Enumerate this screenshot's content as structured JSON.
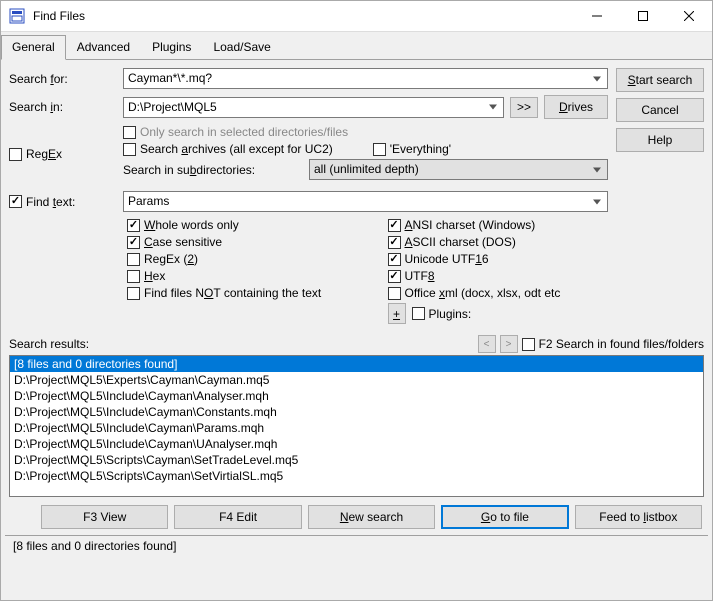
{
  "window": {
    "title": "Find Files"
  },
  "tabs": [
    "General",
    "Advanced",
    "Plugins",
    "Load/Save"
  ],
  "labels": {
    "search_for_pre": "Search ",
    "search_for_u": "f",
    "search_for_post": "or:",
    "search_in_pre": "Search ",
    "search_in_u": "i",
    "search_in_post": "n:",
    "browse_more": ">>",
    "drives_u": "D",
    "drives_post": "rives",
    "regex_pre": "Reg",
    "regex_u": "E",
    "regex_post": "x",
    "only_selected": "Only search in selected directories/files",
    "archives_pre": "Search ",
    "archives_u": "a",
    "archives_post": "rchives (all except for UC2)",
    "everything": "'Everything'",
    "subdirs_pre": "Search in su",
    "subdirs_u": "b",
    "subdirs_post": "directories:",
    "findtext_pre": "Find ",
    "findtext_u": "t",
    "findtext_post": "ext:",
    "whole_u": "W",
    "whole_post": "hole words only",
    "case_u": "C",
    "case_post": "ase sensitive",
    "regex2_pre": "RegEx (",
    "regex2_u": "2",
    "regex2_post": ")",
    "hex_u": "H",
    "hex_post": "ex",
    "notcontain_pre": "Find files N",
    "notcontain_u": "O",
    "notcontain_post": "T containing the text",
    "ansi_u": "A",
    "ansi_post": "NSI charset (Windows)",
    "ascii_u": "A",
    "ascii_post": "SCII charset (DOS)",
    "utf16_pre": "Unicode UTF",
    "utf16_u": "1",
    "utf16_post": "6",
    "utf8_pre": "UTF",
    "utf8_u": "8",
    "office_pre": "Office ",
    "office_u": "x",
    "office_post": "ml (docx, xlsx, odt etc",
    "plus_u": "+",
    "plugins": "Plugins:",
    "search_results": "Search results:",
    "f2_search": "F2 Search in found files/folders"
  },
  "values": {
    "search_for": "Cayman*\\*.mq?",
    "search_in": "D:\\Project\\MQL5",
    "subdirs": "all (unlimited depth)",
    "find_text": "Params"
  },
  "buttons": {
    "start_u": "S",
    "start_post": "tart search",
    "cancel": "Cancel",
    "help": "Help",
    "f3_view": "F3 View",
    "f4_edit": "F4 Edit",
    "newsearch_u": "N",
    "newsearch_post": "ew search",
    "goto_u": "G",
    "goto_post": "o to file",
    "feed_pre": "Feed to ",
    "feed_u": "l",
    "feed_post": "istbox"
  },
  "results": {
    "summary": "[8 files and 0 directories found]",
    "items": [
      "D:\\Project\\MQL5\\Experts\\Cayman\\Cayman.mq5",
      "D:\\Project\\MQL5\\Include\\Cayman\\Analyser.mqh",
      "D:\\Project\\MQL5\\Include\\Cayman\\Constants.mqh",
      "D:\\Project\\MQL5\\Include\\Cayman\\Params.mqh",
      "D:\\Project\\MQL5\\Include\\Cayman\\UAnalyser.mqh",
      "D:\\Project\\MQL5\\Scripts\\Cayman\\SetTradeLevel.mq5",
      "D:\\Project\\MQL5\\Scripts\\Cayman\\SetVirtialSL.mq5"
    ]
  },
  "status": "[8 files and 0 directories found]"
}
